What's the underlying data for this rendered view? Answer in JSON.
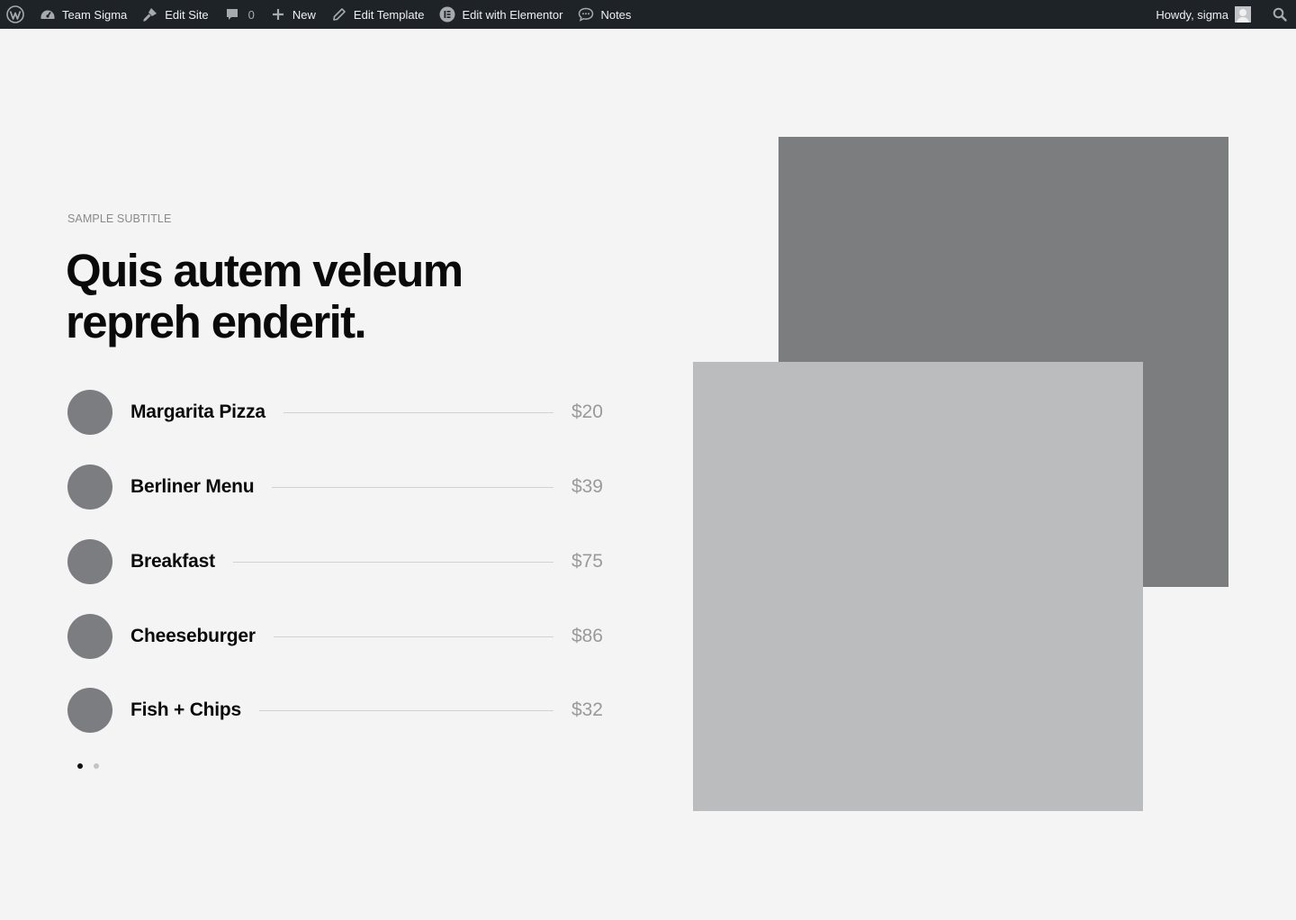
{
  "admin_bar": {
    "site_name": "Team Sigma",
    "edit_site": "Edit Site",
    "comments_count": "0",
    "new": "New",
    "edit_template": "Edit Template",
    "edit_elementor": "Edit with Elementor",
    "notes": "Notes",
    "howdy": "Howdy, sigma",
    "background_color": "#1d2327"
  },
  "section": {
    "subtitle": "SAMPLE SUBTITLE",
    "headline_line1": "Quis autem veleum",
    "headline_line2": "repreh enderit."
  },
  "menu": {
    "items": [
      {
        "name": "Margarita Pizza",
        "price": "$20"
      },
      {
        "name": "Berliner Menu",
        "price": "$39"
      },
      {
        "name": "Breakfast",
        "price": "$75"
      },
      {
        "name": "Cheeseburger",
        "price": "$86"
      },
      {
        "name": "Fish + Chips",
        "price": "$32"
      }
    ]
  },
  "carousel": {
    "pages": 2,
    "active_page": 1
  },
  "colors": {
    "page_background": "#f4f4f4",
    "image_placeholder_dark": "#7c7d7f",
    "image_placeholder_light": "#bbbcbe",
    "price_text": "#9a9a9a"
  }
}
